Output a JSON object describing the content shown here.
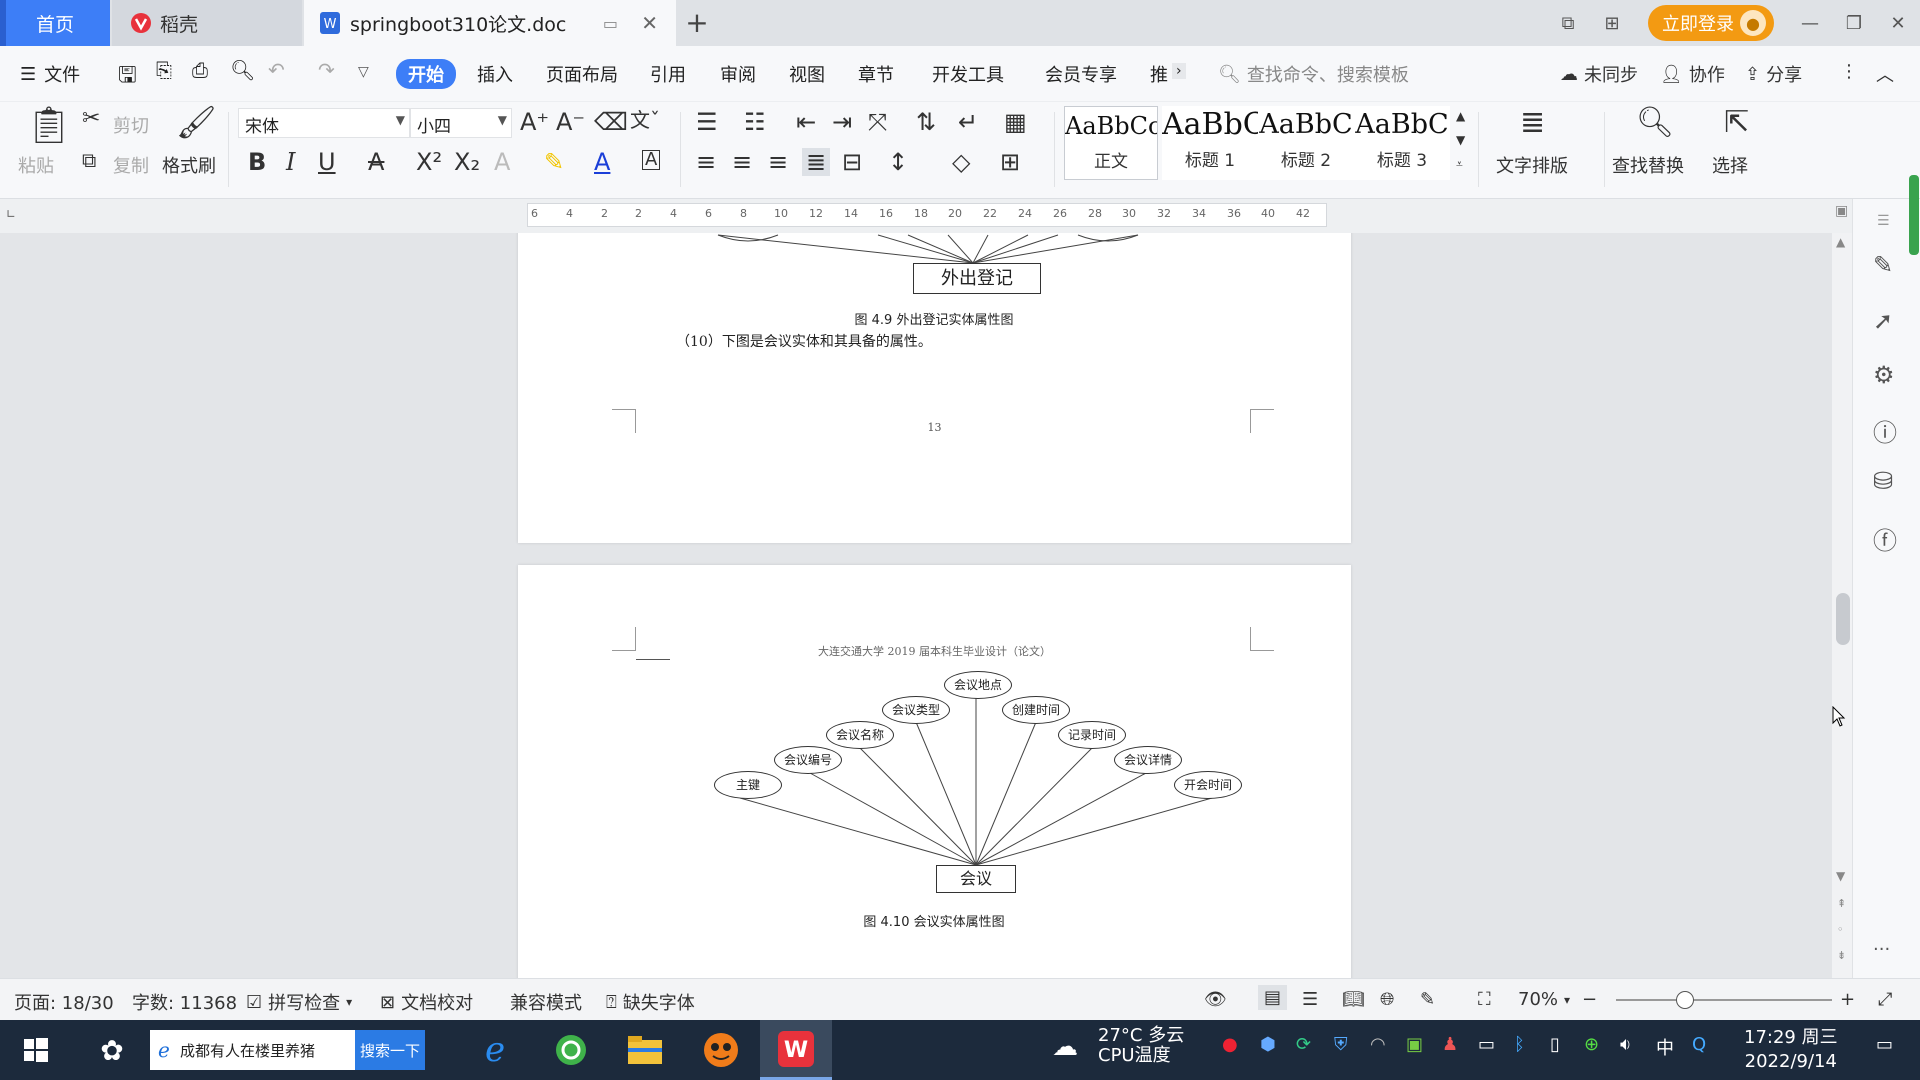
{
  "tabs": {
    "home": "首页",
    "docer": "稻壳",
    "document": "springboot310论文.doc",
    "new_tab": "+"
  },
  "titlebar": {
    "login": "立即登录"
  },
  "menu": {
    "file": "文件",
    "items": [
      "开始",
      "插入",
      "页面布局",
      "引用",
      "审阅",
      "视图",
      "章节",
      "开发工具",
      "会员专享",
      "推"
    ],
    "search_placeholder": "查找命令、搜索模板",
    "sync": "未同步",
    "collab": "协作",
    "share": "分享"
  },
  "ribbon": {
    "paste": "粘贴",
    "cut": "剪切",
    "copy": "复制",
    "format_painter": "格式刷",
    "font_name": "宋体",
    "font_size": "小四",
    "styles": [
      {
        "preview": "AaBbCcI",
        "name": "正文"
      },
      {
        "preview": "AaBbC",
        "name": "标题 1"
      },
      {
        "preview": "AaBbC",
        "name": "标题 2"
      },
      {
        "preview": "AaBbC",
        "name": "标题 3"
      }
    ],
    "text_layout": "文字排版",
    "find_replace": "查找替换",
    "select": "选择"
  },
  "ruler": {
    "ticks": [
      "6",
      "4",
      "2",
      "2",
      "4",
      "6",
      "8",
      "10",
      "12",
      "14",
      "16",
      "18",
      "20",
      "22",
      "24",
      "26",
      "28",
      "30",
      "32",
      "34",
      "36",
      "40",
      "42"
    ]
  },
  "page1": {
    "entity": "外出登记",
    "caption": "图 4.9 外出登记实体属性图",
    "paragraph": "（10）下图是会议实体和其具备的属性。",
    "page_number": "13"
  },
  "page2": {
    "header": "大连交通大学 2019 届本科生毕业设计（论文）",
    "entity": "会议",
    "attributes": [
      "会议地点",
      "会议类型",
      "创建时间",
      "会议名称",
      "记录时间",
      "会议编号",
      "会议详情",
      "主键",
      "开会时间"
    ],
    "caption": "图 4.10  会议实体属性图"
  },
  "status": {
    "page": "页面: 18/30",
    "words": "字数: 11368",
    "spell": "拼写检查",
    "proof": "文档校对",
    "compat": "兼容模式",
    "missing_font": "缺失字体",
    "zoom": "70%"
  },
  "taskbar": {
    "search_text": "成都有人在楼里养猪",
    "search_button": "搜索一下",
    "weather_temp": "27°C",
    "weather_desc": "多云",
    "cpu_label": "CPU温度",
    "ime": "中",
    "time": "17:29 周三",
    "date": "2022/9/14"
  }
}
